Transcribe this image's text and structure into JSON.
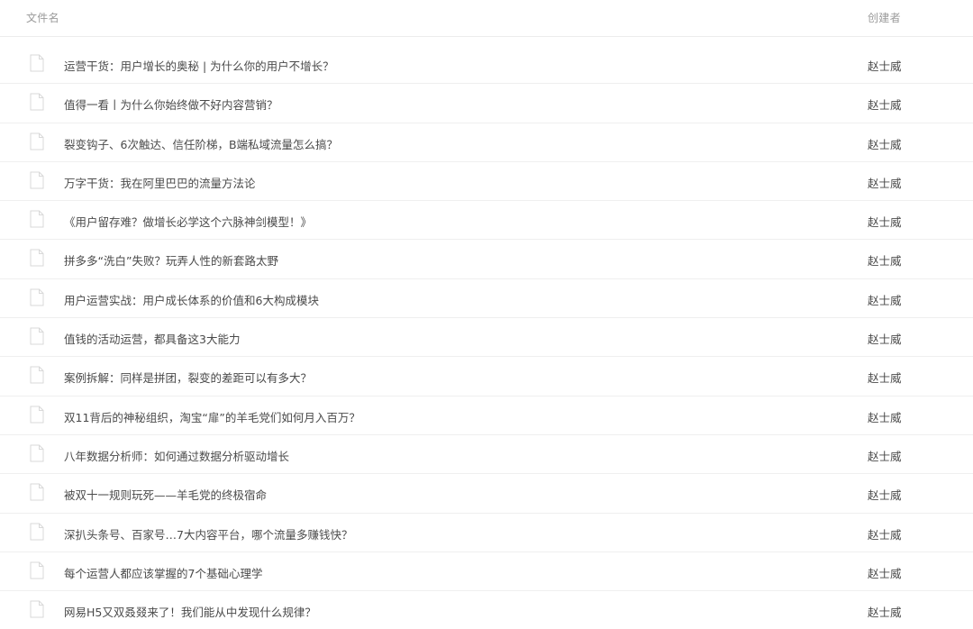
{
  "header": {
    "filename_label": "文件名",
    "creator_label": "创建者"
  },
  "icons": {
    "file": "document-icon"
  },
  "colors": {
    "text": "#4a4a4a",
    "header_text": "#9a9a9a",
    "divider": "#efefef",
    "icon_stroke": "#d9d9d9"
  },
  "files": [
    {
      "name": "运营干货：用户增长的奥秘 | 为什么你的用户不增长？",
      "creator": "赵士威"
    },
    {
      "name": "值得一看丨为什么你始终做不好内容营销？",
      "creator": "赵士威"
    },
    {
      "name": "裂变钩子、6次触达、信任阶梯，B端私域流量怎么搞？",
      "creator": "赵士威"
    },
    {
      "name": "万字干货：我在阿里巴巴的流量方法论",
      "creator": "赵士威"
    },
    {
      "name": "《用户留存难？做增长必学这个六脉神剑模型！》",
      "creator": "赵士威"
    },
    {
      "name": "拼多多“洗白”失败？玩弄人性的新套路太野",
      "creator": "赵士威"
    },
    {
      "name": "用户运营实战：用户成长体系的价值和6大构成模块",
      "creator": "赵士威"
    },
    {
      "name": "值钱的活动运营，都具备这3大能力",
      "creator": "赵士威"
    },
    {
      "name": "案例拆解：同样是拼团，裂变的差距可以有多大？",
      "creator": "赵士威"
    },
    {
      "name": "双11背后的神秘组织，淘宝“扉”的羊毛党们如何月入百万？",
      "creator": "赵士威"
    },
    {
      "name": "八年数据分析师：如何通过数据分析驱动增长",
      "creator": "赵士威"
    },
    {
      "name": "被双十一规则玩死——羊毛党的终极宿命",
      "creator": "赵士威"
    },
    {
      "name": "深扒头条号、百家号…7大内容平台，哪个流量多赚钱快？",
      "creator": "赵士威"
    },
    {
      "name": "每个运营人都应该掌握的7个基础心理学",
      "creator": "赵士威"
    },
    {
      "name": "网易H5又双叒叕来了！我们能从中发现什么规律？",
      "creator": "赵士威"
    }
  ]
}
